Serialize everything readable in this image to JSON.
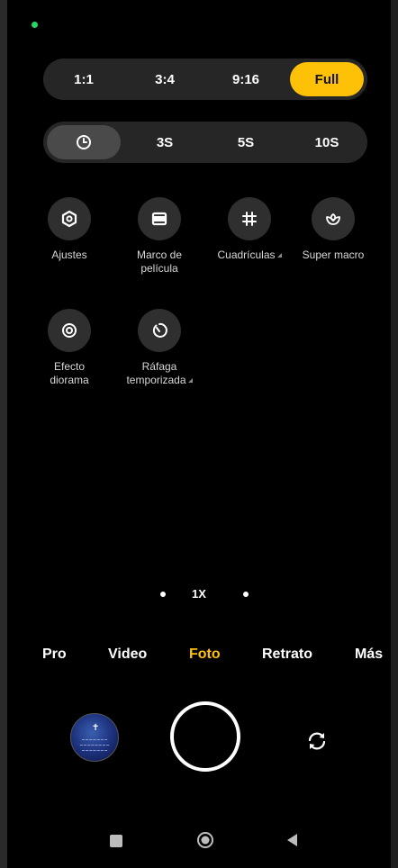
{
  "aspect": {
    "options": [
      "1:1",
      "3:4",
      "9:16",
      "Full"
    ],
    "selected": "Full"
  },
  "timer": {
    "options": [
      "clock-icon",
      "3S",
      "5S",
      "10S"
    ],
    "selected": "clock-icon"
  },
  "options": {
    "ajustes": "Ajustes",
    "marco_line1": "Marco de",
    "marco_line2": "película",
    "cuadriculas": "Cuadrículas",
    "super_macro": "Super macro",
    "efecto_line1": "Efecto",
    "efecto_line2": "diorama",
    "rafaga_line1": "Ráfaga",
    "rafaga_line2": "temporizada"
  },
  "zoom": {
    "level": "1X"
  },
  "modes": {
    "items": [
      "Pro",
      "Video",
      "Foto",
      "Retrato",
      "Más"
    ],
    "selected": "Foto"
  },
  "colors": {
    "accent": "#ffc107",
    "background": "#000000",
    "pill": "#262626"
  }
}
